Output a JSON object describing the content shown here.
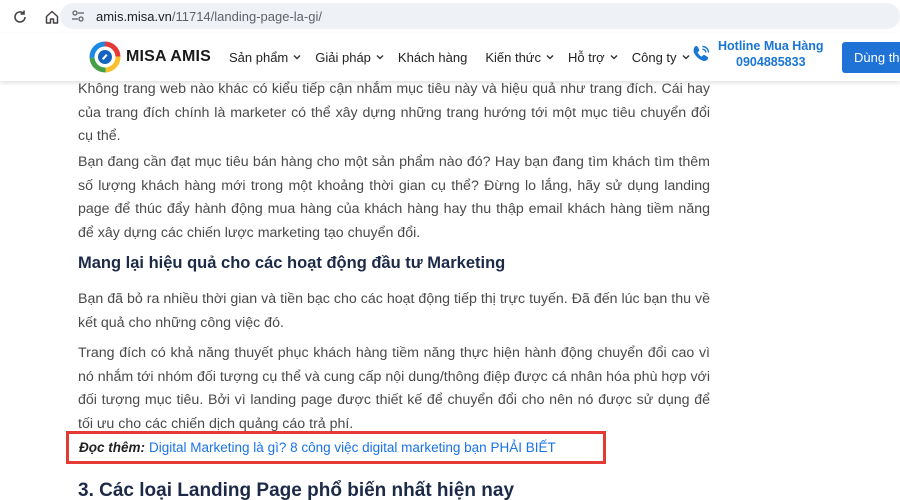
{
  "browser": {
    "url_host": "amis.misa.vn",
    "url_path": "/11714/landing-page-la-gi/"
  },
  "header": {
    "logo_text": "MISA AMIS",
    "menu": [
      {
        "label": "Sản phẩm"
      },
      {
        "label": "Giải pháp"
      },
      {
        "label": "Khách hàng"
      },
      {
        "label": "Kiến thức"
      },
      {
        "label": "Hỗ trợ"
      },
      {
        "label": "Công ty"
      }
    ],
    "hotline_title": "Hotline Mua Hàng",
    "hotline_phone": "0904885833",
    "cta_label": "Dùng thử",
    "accent_color": "#1f73d6"
  },
  "article": {
    "p1": "Không trang web nào khác có kiểu tiếp cận nhắm mục tiêu này và hiệu quả như trang đích. Cái hay của trang đích chính là marketer có thể xây dựng những trang hướng tới một mục tiêu chuyển đổi cụ thể.",
    "p2": "Bạn đang cần đạt mục tiêu bán hàng cho một sản phẩm nào đó? Hay bạn đang tìm khách tìm thêm số lượng khách hàng mới trong một khoảng thời gian cụ thể? Đừng lo lắng, hãy sử dụng landing page để thúc đẩy hành động mua hàng của khách hàng hay thu thập email khách hàng tiềm năng để xây dựng các chiến lược marketing tạo chuyển đổi.",
    "subheading": "Mang lại hiệu quả cho các hoạt động đầu tư Marketing",
    "p3": "Bạn đã bỏ ra nhiều thời gian và tiền bạc cho các hoạt động tiếp thị trực tuyến. Đã đến lúc bạn thu về kết quả cho những công việc đó.",
    "p4": "Trang đích có khả năng thuyết phục khách hàng tiềm năng thực hiện hành động chuyển đổi cao vì nó nhắm tới nhóm đối tượng cụ thể và cung cấp nội dung/thông điệp được cá nhân hóa phù hợp với đối tượng mục tiêu. Bởi vì landing page được thiết kế để chuyển đổi cho nên nó được sử dụng để tối ưu cho các chiến dịch quảng cáo trả phí.",
    "read_more_label": "Đọc thêm:",
    "read_more_link": "Digital Marketing là gì? 8 công việc digital marketing bạn PHẢI BIẾT",
    "heading_3": "3. Các loại Landing Page phổ biến nhất hiện nay"
  }
}
